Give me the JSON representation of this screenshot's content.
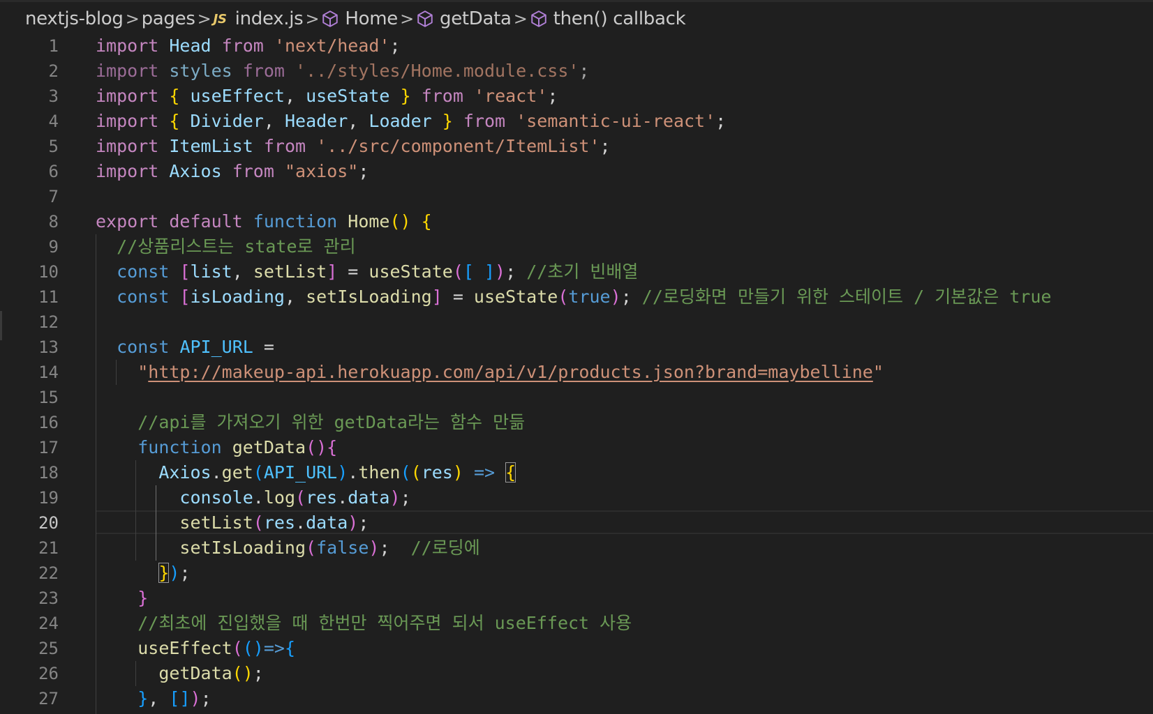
{
  "breadcrumbs": {
    "root": "nextjs-blog",
    "folder": "pages",
    "file_badge": "JS",
    "file": "index.js",
    "symbol1": "Home",
    "symbol2": "getData",
    "symbol3": "then() callback",
    "separator": ">"
  },
  "editor": {
    "language": "javascript",
    "active_line": 20,
    "line_numbers": [
      "1",
      "2",
      "3",
      "4",
      "5",
      "6",
      "7",
      "8",
      "9",
      "10",
      "11",
      "12",
      "13",
      "14",
      "15",
      "16",
      "17",
      "18",
      "19",
      "20",
      "21",
      "22",
      "23",
      "24",
      "25",
      "26",
      "27"
    ],
    "lines": [
      [
        {
          "t": "import",
          "c": "kw"
        },
        {
          "t": " "
        },
        {
          "t": "Head",
          "c": "vr"
        },
        {
          "t": " "
        },
        {
          "t": "from",
          "c": "kw"
        },
        {
          "t": " "
        },
        {
          "t": "'next/head'",
          "c": "str"
        },
        {
          "t": ";"
        }
      ],
      [
        {
          "t": "import styles from '../styles/Home.module.css';",
          "c": "dim-mix"
        }
      ],
      [
        {
          "t": "import",
          "c": "kw"
        },
        {
          "t": " "
        },
        {
          "t": "{",
          "c": "b1"
        },
        {
          "t": " "
        },
        {
          "t": "useEffect",
          "c": "vr"
        },
        {
          "t": ", "
        },
        {
          "t": "useState",
          "c": "vr"
        },
        {
          "t": " "
        },
        {
          "t": "}",
          "c": "b1"
        },
        {
          "t": " "
        },
        {
          "t": "from",
          "c": "kw"
        },
        {
          "t": " "
        },
        {
          "t": "'react'",
          "c": "str"
        },
        {
          "t": ";"
        }
      ],
      [
        {
          "t": "import",
          "c": "kw"
        },
        {
          "t": " "
        },
        {
          "t": "{",
          "c": "b1"
        },
        {
          "t": " "
        },
        {
          "t": "Divider",
          "c": "vr"
        },
        {
          "t": ", "
        },
        {
          "t": "Header",
          "c": "vr"
        },
        {
          "t": ", "
        },
        {
          "t": "Loader",
          "c": "vr"
        },
        {
          "t": " "
        },
        {
          "t": "}",
          "c": "b1"
        },
        {
          "t": " "
        },
        {
          "t": "from",
          "c": "kw"
        },
        {
          "t": " "
        },
        {
          "t": "'semantic-ui-react'",
          "c": "str"
        },
        {
          "t": ";"
        }
      ],
      [
        {
          "t": "import",
          "c": "kw"
        },
        {
          "t": " "
        },
        {
          "t": "ItemList",
          "c": "vr"
        },
        {
          "t": " "
        },
        {
          "t": "from",
          "c": "kw"
        },
        {
          "t": " "
        },
        {
          "t": "'../src/component/ItemList'",
          "c": "str"
        },
        {
          "t": ";"
        }
      ],
      [
        {
          "t": "import",
          "c": "kw"
        },
        {
          "t": " "
        },
        {
          "t": "Axios",
          "c": "vr"
        },
        {
          "t": " "
        },
        {
          "t": "from",
          "c": "kw"
        },
        {
          "t": " "
        },
        {
          "t": "\"axios\"",
          "c": "str"
        },
        {
          "t": ";"
        }
      ],
      [],
      [
        {
          "t": "export",
          "c": "kw"
        },
        {
          "t": " "
        },
        {
          "t": "default",
          "c": "kw"
        },
        {
          "t": " "
        },
        {
          "t": "function",
          "c": "st"
        },
        {
          "t": " "
        },
        {
          "t": "Home",
          "c": "fn"
        },
        {
          "t": "()",
          "c": "b1"
        },
        {
          "t": " "
        },
        {
          "t": "{",
          "c": "b1"
        }
      ],
      [
        {
          "t": "  "
        },
        {
          "t": "//상품리스트는 state로 관리",
          "c": "cm"
        }
      ],
      [
        {
          "t": "  "
        },
        {
          "t": "const",
          "c": "st"
        },
        {
          "t": " "
        },
        {
          "t": "[",
          "c": "b2"
        },
        {
          "t": "list",
          "c": "vr"
        },
        {
          "t": ", "
        },
        {
          "t": "setList",
          "c": "fn"
        },
        {
          "t": "]",
          "c": "b2"
        },
        {
          "t": " = "
        },
        {
          "t": "useState",
          "c": "fn"
        },
        {
          "t": "(",
          "c": "b2"
        },
        {
          "t": "[ ]",
          "c": "b3"
        },
        {
          "t": ")",
          "c": "b2"
        },
        {
          "t": "; "
        },
        {
          "t": "//초기 빈배열",
          "c": "cm"
        }
      ],
      [
        {
          "t": "  "
        },
        {
          "t": "const",
          "c": "st"
        },
        {
          "t": " "
        },
        {
          "t": "[",
          "c": "b2"
        },
        {
          "t": "isLoading",
          "c": "vr"
        },
        {
          "t": ", "
        },
        {
          "t": "setIsLoading",
          "c": "fn"
        },
        {
          "t": "]",
          "c": "b2"
        },
        {
          "t": " = "
        },
        {
          "t": "useState",
          "c": "fn"
        },
        {
          "t": "(",
          "c": "b2"
        },
        {
          "t": "true",
          "c": "st"
        },
        {
          "t": ")",
          "c": "b2"
        },
        {
          "t": "; "
        },
        {
          "t": "//로딩화면 만들기 위한 스테이트 / 기본값은 true",
          "c": "cm"
        }
      ],
      [],
      [
        {
          "t": "  "
        },
        {
          "t": "const",
          "c": "st"
        },
        {
          "t": " "
        },
        {
          "t": "API_URL",
          "c": "cn"
        },
        {
          "t": " ="
        }
      ],
      [
        {
          "t": "    "
        },
        {
          "t": "\"",
          "c": "str"
        },
        {
          "t": "http://makeup-api.herokuapp.com/api/v1/products.json?brand=maybelline",
          "c": "url"
        },
        {
          "t": "\"",
          "c": "str"
        }
      ],
      [],
      [
        {
          "t": "    "
        },
        {
          "t": "//api를 가져오기 위한 getData라는 함수 만듦",
          "c": "cm"
        }
      ],
      [
        {
          "t": "    "
        },
        {
          "t": "function",
          "c": "st"
        },
        {
          "t": " "
        },
        {
          "t": "getData",
          "c": "fn"
        },
        {
          "t": "()",
          "c": "b2"
        },
        {
          "t": "{",
          "c": "b2"
        }
      ],
      [
        {
          "t": "      "
        },
        {
          "t": "Axios",
          "c": "vr"
        },
        {
          "t": "."
        },
        {
          "t": "get",
          "c": "fn"
        },
        {
          "t": "(",
          "c": "b3"
        },
        {
          "t": "API_URL",
          "c": "cn"
        },
        {
          "t": ")",
          "c": "b3"
        },
        {
          "t": "."
        },
        {
          "t": "then",
          "c": "fn"
        },
        {
          "t": "(",
          "c": "b3"
        },
        {
          "t": "(",
          "c": "b1"
        },
        {
          "t": "res",
          "c": "vr"
        },
        {
          "t": ")",
          "c": "b1"
        },
        {
          "t": " "
        },
        {
          "t": "=>",
          "c": "st"
        },
        {
          "t": " "
        },
        {
          "t": "{",
          "c": "b1 match"
        }
      ],
      [
        {
          "t": "        "
        },
        {
          "t": "console",
          "c": "vr"
        },
        {
          "t": "."
        },
        {
          "t": "log",
          "c": "fn"
        },
        {
          "t": "(",
          "c": "b2"
        },
        {
          "t": "res",
          "c": "vr"
        },
        {
          "t": "."
        },
        {
          "t": "data",
          "c": "vr"
        },
        {
          "t": ")",
          "c": "b2"
        },
        {
          "t": ";"
        }
      ],
      [
        {
          "t": "        "
        },
        {
          "t": "setList",
          "c": "fn"
        },
        {
          "t": "(",
          "c": "b2"
        },
        {
          "t": "res",
          "c": "vr"
        },
        {
          "t": "."
        },
        {
          "t": "data",
          "c": "vr"
        },
        {
          "t": ")",
          "c": "b2"
        },
        {
          "t": ";"
        }
      ],
      [
        {
          "t": "        "
        },
        {
          "t": "setIsLoading",
          "c": "fn"
        },
        {
          "t": "(",
          "c": "b2"
        },
        {
          "t": "false",
          "c": "st"
        },
        {
          "t": ")",
          "c": "b2"
        },
        {
          "t": ";  "
        },
        {
          "t": "//로딩에",
          "c": "cm"
        }
      ],
      [
        {
          "t": "      "
        },
        {
          "t": "}",
          "c": "b1 match"
        },
        {
          "t": ")",
          "c": "b3"
        },
        {
          "t": ";"
        }
      ],
      [
        {
          "t": "    "
        },
        {
          "t": "}",
          "c": "b2"
        }
      ],
      [
        {
          "t": "    "
        },
        {
          "t": "//최초에 진입했을 때 한번만 찍어주면 되서 useEffect 사용",
          "c": "cm"
        }
      ],
      [
        {
          "t": "    "
        },
        {
          "t": "useEffect",
          "c": "fn"
        },
        {
          "t": "(",
          "c": "b2"
        },
        {
          "t": "()",
          "c": "b3"
        },
        {
          "t": "=>",
          "c": "st"
        },
        {
          "t": "{",
          "c": "b3"
        }
      ],
      [
        {
          "t": "      "
        },
        {
          "t": "getData",
          "c": "fn"
        },
        {
          "t": "()",
          "c": "b1"
        },
        {
          "t": ";"
        }
      ],
      [
        {
          "t": "    "
        },
        {
          "t": "}",
          "c": "b3"
        },
        {
          "t": ", "
        },
        {
          "t": "[]",
          "c": "b3"
        },
        {
          "t": ")",
          "c": "b2"
        },
        {
          "t": ";"
        }
      ]
    ]
  }
}
